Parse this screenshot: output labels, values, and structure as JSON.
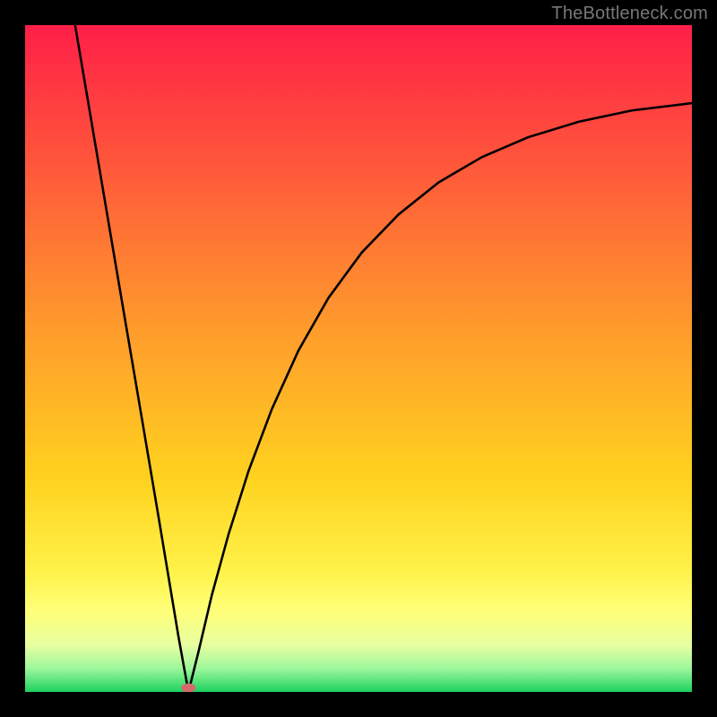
{
  "watermark": "TheBottleneck.com",
  "chart_data": {
    "type": "line",
    "title": "",
    "xlabel": "",
    "ylabel": "",
    "xlim": [
      0,
      100
    ],
    "ylim": [
      0,
      100
    ],
    "grid": false,
    "pink_marker": {
      "x": 24.5,
      "y": 0.6
    },
    "series": [
      {
        "name": "curve",
        "color": "#000000",
        "points": [
          {
            "x": 7.5,
            "y": 100.0
          },
          {
            "x": 10.6,
            "y": 81.7
          },
          {
            "x": 13.7,
            "y": 63.4
          },
          {
            "x": 16.8,
            "y": 45.2
          },
          {
            "x": 19.9,
            "y": 26.9
          },
          {
            "x": 23.0,
            "y": 8.3
          },
          {
            "x": 24.5,
            "y": 0.0
          },
          {
            "x": 26.0,
            "y": 6.0
          },
          {
            "x": 28.0,
            "y": 14.5
          },
          {
            "x": 30.5,
            "y": 23.6
          },
          {
            "x": 33.5,
            "y": 33.1
          },
          {
            "x": 37.0,
            "y": 42.4
          },
          {
            "x": 41.0,
            "y": 51.2
          },
          {
            "x": 45.5,
            "y": 59.1
          },
          {
            "x": 50.5,
            "y": 65.9
          },
          {
            "x": 56.0,
            "y": 71.6
          },
          {
            "x": 62.0,
            "y": 76.4
          },
          {
            "x": 68.5,
            "y": 80.2
          },
          {
            "x": 75.5,
            "y": 83.2
          },
          {
            "x": 83.0,
            "y": 85.5
          },
          {
            "x": 91.0,
            "y": 87.2
          },
          {
            "x": 100.0,
            "y": 88.3
          }
        ]
      }
    ],
    "background_gradient": {
      "stops": [
        {
          "offset": 0.0,
          "color": "#ff1f48"
        },
        {
          "offset": 0.22,
          "color": "#ff5a3a"
        },
        {
          "offset": 0.45,
          "color": "#ff9a2c"
        },
        {
          "offset": 0.68,
          "color": "#ffd21f"
        },
        {
          "offset": 0.82,
          "color": "#fff249"
        },
        {
          "offset": 0.88,
          "color": "#ffff7a"
        },
        {
          "offset": 0.93,
          "color": "#e7ffa0"
        },
        {
          "offset": 0.965,
          "color": "#9cf79c"
        },
        {
          "offset": 1.0,
          "color": "#1dd15e"
        }
      ]
    }
  }
}
